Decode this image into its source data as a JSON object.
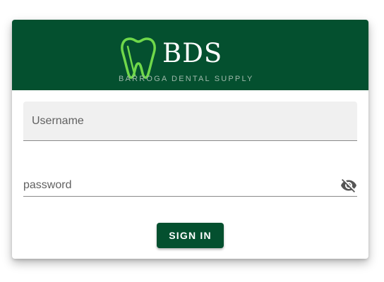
{
  "brand": {
    "name": "BDS",
    "tagline": "BARROGA DENTAL SUPPLY",
    "icon": "tooth-icon",
    "header_color": "#04502f",
    "icon_color": "#6fd84a"
  },
  "login_form": {
    "username_placeholder": "Username",
    "password_placeholder": "password",
    "visibility_icon": "eye-off-icon",
    "submit_label": "SIGN IN",
    "button_color": "#04502f"
  }
}
